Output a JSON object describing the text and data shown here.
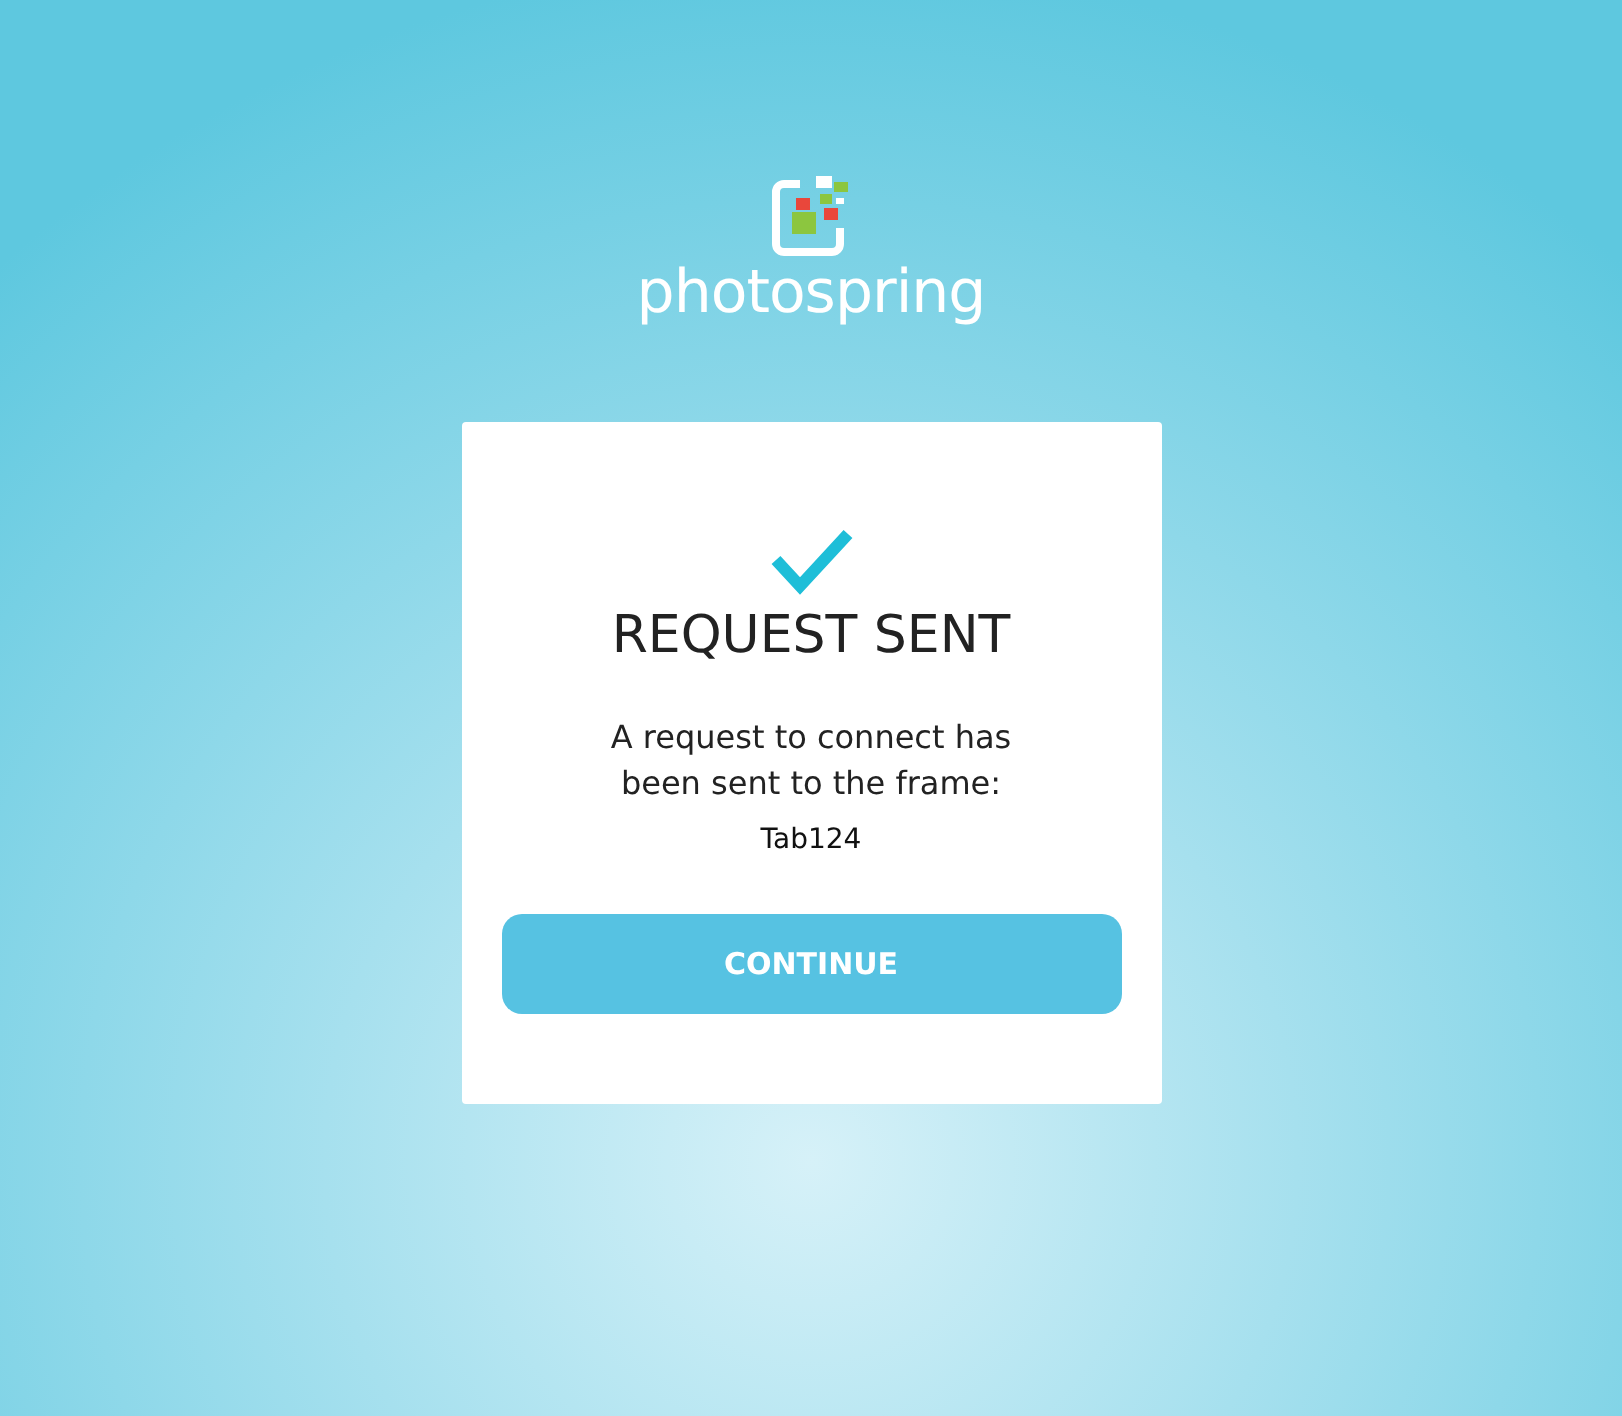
{
  "logo": {
    "wordmark": "photospring"
  },
  "dialog": {
    "title": "REQUEST SENT",
    "message": "A request to connect has been sent to the frame:",
    "frame_name": "Tab124",
    "button": "CONTINUE"
  }
}
